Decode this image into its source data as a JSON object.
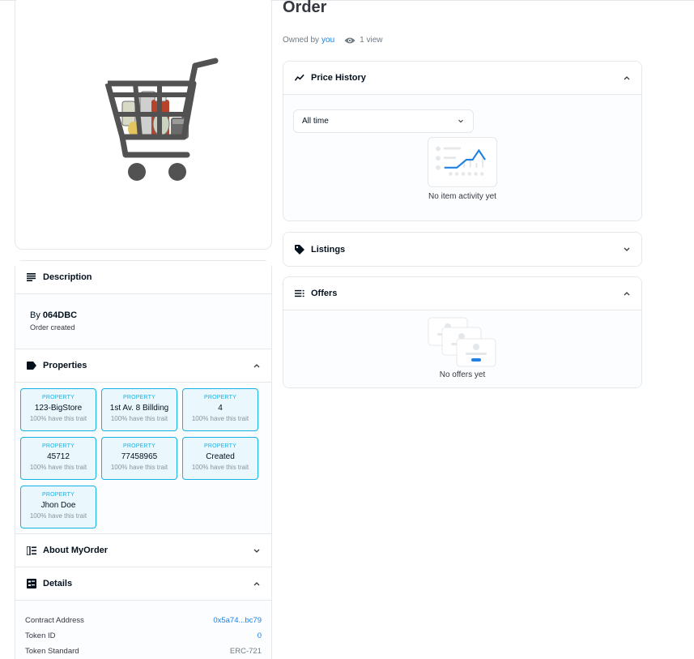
{
  "item": {
    "title": "Order",
    "owned_prefix": "Owned by",
    "owner": "you",
    "views": "1 view"
  },
  "description": {
    "header": "Description",
    "by_prefix": "By",
    "creator": "064DBC",
    "text": "Order created"
  },
  "properties": {
    "header": "Properties",
    "items": [
      {
        "type": "PROPERTY",
        "value": "123-BigStore",
        "rarity": "100% have this trait"
      },
      {
        "type": "PROPERTY",
        "value": "1st Av. 8 Billding",
        "rarity": "100% have this trait"
      },
      {
        "type": "PROPERTY",
        "value": "4",
        "rarity": "100% have this trait"
      },
      {
        "type": "PROPERTY",
        "value": "45712",
        "rarity": "100% have this trait"
      },
      {
        "type": "PROPERTY",
        "value": "77458965",
        "rarity": "100% have this trait"
      },
      {
        "type": "PROPERTY",
        "value": "Created",
        "rarity": "100% have this trait"
      },
      {
        "type": "PROPERTY",
        "value": "Jhon Doe",
        "rarity": "100% have this trait"
      }
    ]
  },
  "about": {
    "header": "About MyOrder"
  },
  "details": {
    "header": "Details",
    "rows": [
      {
        "label": "Contract Address",
        "value": "0x5a74...bc79"
      },
      {
        "label": "Token ID",
        "value": "0"
      },
      {
        "label": "Token Standard",
        "value": "ERC-721"
      }
    ]
  },
  "price_history": {
    "header": "Price History",
    "filter": "All time",
    "empty_text": "No item activity yet"
  },
  "listings": {
    "header": "Listings"
  },
  "offers": {
    "header": "Offers",
    "empty_text": "No offers yet"
  },
  "colors": {
    "accent_link": "#2081e2",
    "property_border": "#15b2e5",
    "property_bg": "#eaf7fd",
    "text_primary": "#04111d",
    "border": "#e5e8eb"
  },
  "icons": [
    "shopping-cart-image",
    "eye-icon",
    "description-lines-icon",
    "tag-icon",
    "about-list-icon",
    "details-icon",
    "price-trend-icon",
    "offers-list-icon",
    "chevron-up-icon",
    "chevron-down-icon"
  ]
}
